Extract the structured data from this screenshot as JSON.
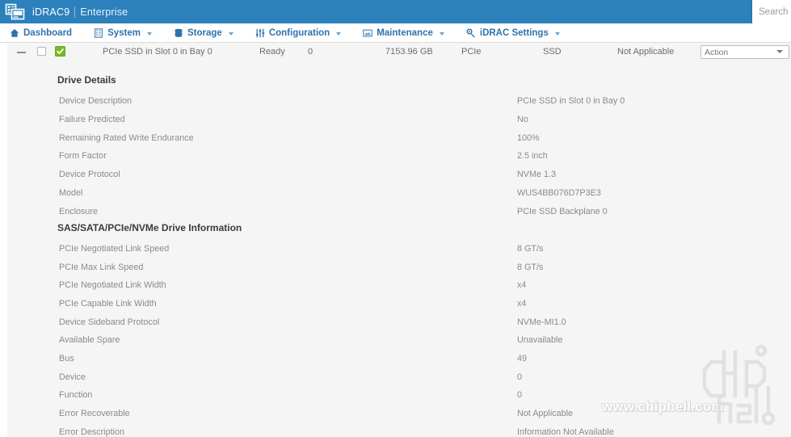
{
  "brand": {
    "logo_icon": "server-rack-icon",
    "name": "iDRAC9",
    "edition": "Enterprise"
  },
  "search": {
    "placeholder": "Search",
    "value": "",
    "icon": "search-icon"
  },
  "nav": {
    "items": [
      {
        "label": "Dashboard",
        "icon": "home-icon",
        "has_caret": false
      },
      {
        "label": "System",
        "icon": "server-icon",
        "has_caret": true
      },
      {
        "label": "Storage",
        "icon": "database-icon",
        "has_caret": true
      },
      {
        "label": "Configuration",
        "icon": "sliders-icon",
        "has_caret": true
      },
      {
        "label": "Maintenance",
        "icon": "window-icon",
        "has_caret": true
      },
      {
        "label": "iDRAC Settings",
        "icon": "wrench-gear-icon",
        "has_caret": true
      }
    ]
  },
  "drive_row": {
    "collapse_icon": "minus-icon",
    "checkbox_checked": false,
    "status_icon": "green-check-icon",
    "status_color": "#76bc21",
    "name": "PCIe SSD in Slot 0 in Bay 0",
    "state": "Ready",
    "slot": "0",
    "capacity": "7153.96 GB",
    "bus_protocol": "PCIe",
    "media_type": "SSD",
    "hot_spare": "Not Applicable",
    "action_label": "Action",
    "action_options": [
      "Action"
    ]
  },
  "sections": [
    {
      "title": "Drive Details",
      "rows": [
        {
          "label": "Device Description",
          "value": "PCIe SSD in Slot 0 in Bay 0"
        },
        {
          "label": "Failure Predicted",
          "value": "No"
        },
        {
          "label": "Remaining Rated Write Endurance",
          "value": "100%"
        },
        {
          "label": "Form Factor",
          "value": "2.5 inch"
        },
        {
          "label": "Device Protocol",
          "value": "NVMe 1.3"
        },
        {
          "label": "Model",
          "value": "WUS4BB076D7P3E3"
        },
        {
          "label": "Enclosure",
          "value": "PCIe SSD Backplane 0"
        }
      ]
    },
    {
      "title": "SAS/SATA/PCIe/NVMe Drive Information",
      "rows": [
        {
          "label": "PCIe Negotiated Link Speed",
          "value": "8 GT/s"
        },
        {
          "label": "PCIe Max Link Speed",
          "value": "8 GT/s"
        },
        {
          "label": "PCIe Negotiated Link Width",
          "value": "x4"
        },
        {
          "label": "PCIe Capable Link Width",
          "value": "x4"
        },
        {
          "label": "Device Sideband Protocol",
          "value": "NVMe-MI1.0"
        },
        {
          "label": "Available Spare",
          "value": "Unavailable"
        },
        {
          "label": "Bus",
          "value": "49"
        },
        {
          "label": "Device",
          "value": "0"
        },
        {
          "label": "Function",
          "value": "0"
        },
        {
          "label": "Error Recoverable",
          "value": "Not Applicable"
        },
        {
          "label": "Error Description",
          "value": "Information Not Available"
        }
      ]
    }
  ],
  "watermark": {
    "url_text": "www.chiphell.com",
    "logo_text": "chiphell"
  },
  "colors": {
    "brand_bar": "#2c80bb",
    "nav_link": "#2f72ad",
    "content_bg": "#f5f5f5",
    "label_text": "#8a8a8a",
    "status_green": "#76bc21"
  }
}
